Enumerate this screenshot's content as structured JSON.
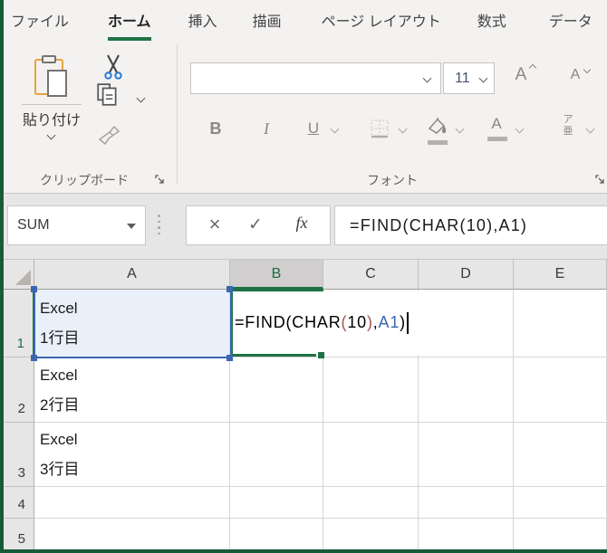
{
  "tabs": [
    {
      "label": "ファイル"
    },
    {
      "label": "ホーム",
      "active": true
    },
    {
      "label": "挿入"
    },
    {
      "label": "描画"
    },
    {
      "label": "ページ レイアウト"
    },
    {
      "label": "数式"
    },
    {
      "label": "データ"
    }
  ],
  "ribbon": {
    "clipboard": {
      "paste_label": "貼り付け",
      "group_label": "クリップボード"
    },
    "font": {
      "size_value": "11",
      "bold_label": "B",
      "italic_label": "I",
      "underline_label": "U",
      "grow_label": "A",
      "shrink_label": "A",
      "phonetic_top": "ア",
      "phonetic_bottom": "亜",
      "group_label": "フォント"
    }
  },
  "formula_bar": {
    "name_box_value": "SUM",
    "cancel_glyph": "×",
    "enter_glyph": "✓",
    "fx_glyph": "fx",
    "formula_text": "=FIND(CHAR(10),A1)"
  },
  "grid": {
    "col_headers": [
      "A",
      "B",
      "C",
      "D",
      "E"
    ],
    "row_headers": [
      "1",
      "2",
      "3",
      "4",
      "5"
    ],
    "a1": {
      "l1": "Excel",
      "l2": "1行目"
    },
    "a2": {
      "l1": "Excel",
      "l2": "2行目"
    },
    "a3": {
      "l1": "Excel",
      "l2": "3行目"
    },
    "b1_formula": {
      "p1": "=FIND(CHAR",
      "p2": "(",
      "p3": "10",
      "p4": ")",
      "p5": ",",
      "p6": "A1",
      "p7": ")"
    }
  },
  "colors": {
    "accent_green": "#217346",
    "active_cell_green": "#1e7145",
    "range_ref_blue": "#3b66b0",
    "formula_paren_red": "#a5544a",
    "referenced_cell_fill": "#e9f0f9"
  }
}
